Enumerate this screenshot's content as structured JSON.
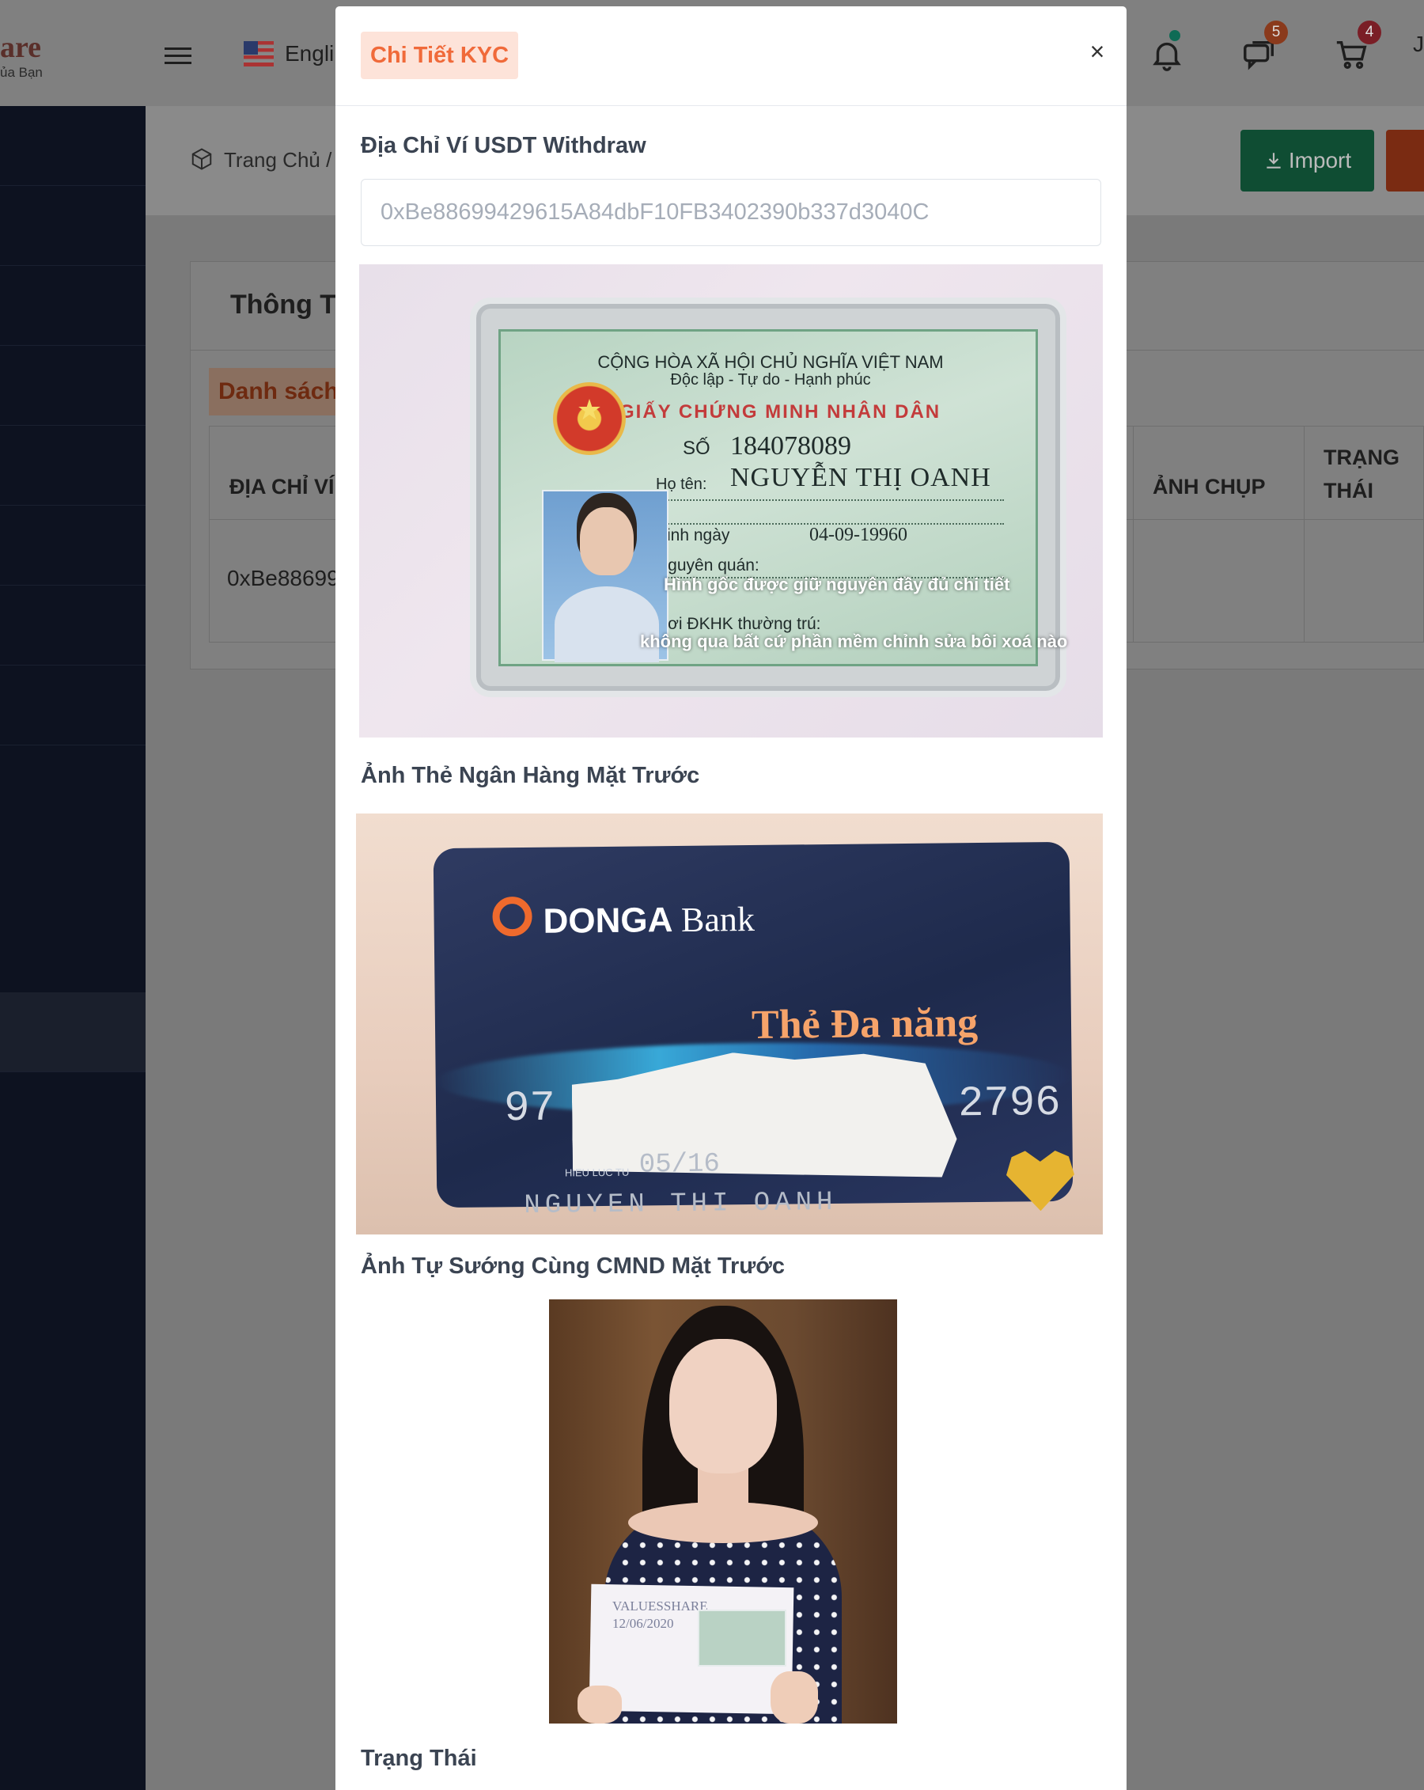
{
  "app": {
    "logo_text": "are",
    "logo_sub": "ủa Bạn",
    "language_label": "Engli",
    "user_glyph": "J",
    "notifications": {
      "messages_count": "5",
      "cart_count": "4"
    },
    "colors": {
      "sidebar": "#0d1220",
      "accent": "#f06a3a",
      "import": "#1e7d4e"
    }
  },
  "page": {
    "breadcrumb": "Trang Chủ  /",
    "import_label": "Import",
    "card_title": "Thông Ti",
    "list_badge": "Danh sách",
    "table": {
      "col_wallet": "ĐỊA CHỈ VÍ",
      "col_photo": "ẢNH CHỤP",
      "col_status_1": "TRẠNG",
      "col_status_2": "THÁI",
      "row_wallet": "0xBe88699"
    }
  },
  "modal": {
    "title": "Chi Tiết KYC",
    "close_glyph": "×",
    "wallet_label": "Địa Chỉ Ví USDT Withdraw",
    "wallet_value": "0xBe88699429615A84dbF10FB3402390b337d3040C",
    "id_card": {
      "line1": "CỘNG HÒA XÃ HỘI CHỦ NGHĨA VIỆT NAM",
      "line2": "Độc lập - Tự do - Hạnh phúc",
      "line3": "GIẤY CHỨNG MINH NHÂN DÂN",
      "number_label": "SỐ",
      "number": "184078089",
      "name_label": "Họ tên:",
      "name": "NGUYỄN THỊ OANH",
      "dob_label": "Sinh ngày",
      "dob": "04-09-19960",
      "origin_label": "Nguyên quán:",
      "residence_label": "Nơi ĐKHK thường trú:",
      "overlay_1": "Hình gốc được giữ nguyên đầy đủ chi tiết",
      "overlay_2": "không qua bất cứ phần mềm chỉnh sửa bôi xoá nào"
    },
    "bank_label": "Ảnh Thẻ Ngân Hàng Mặt Trước",
    "bank_card": {
      "brand": "DONGA",
      "brand_word": "Bank",
      "tagline": "Thẻ Đa năng",
      "digits_start": "97",
      "digits_end": "2796",
      "valid_label": "HIEU LUC TU",
      "valid_date": "05/16",
      "holder": "NGUYEN THI OANH"
    },
    "selfie_label": "Ảnh Tự Sướng Cùng CMND Mặt Trước",
    "selfie_paper": {
      "line1": "VALUESSHARE",
      "line2": "12/06/2020"
    },
    "status_label": "Trạng Thái"
  }
}
